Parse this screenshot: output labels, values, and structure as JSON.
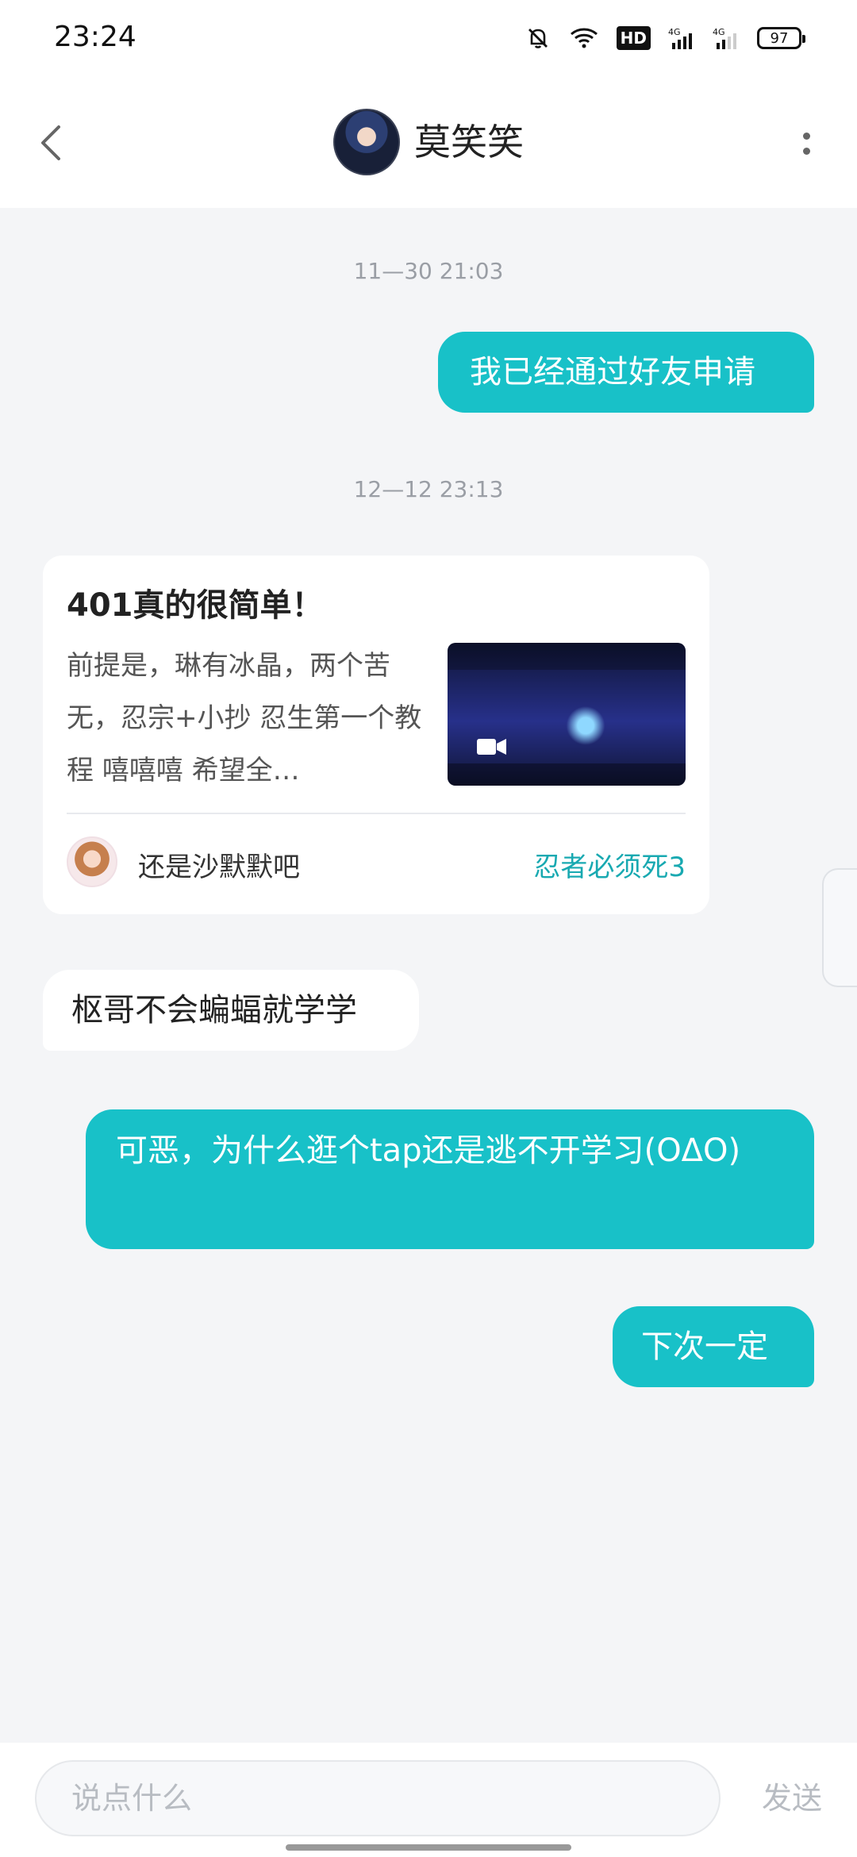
{
  "status_bar": {
    "time": "23:24",
    "hd_label": "HD",
    "battery_level": "97"
  },
  "header": {
    "contact_name": "莫笑笑"
  },
  "chat": {
    "timestamps": [
      "11—30 21:03",
      "12—12 23:13"
    ],
    "messages": [
      {
        "sender": "me",
        "text": "我已经通过好友申请"
      },
      {
        "sender": "other",
        "text": "枢哥不会蝙蝠就学学"
      },
      {
        "sender": "me",
        "text": "可恶，为什么逛个tap还是逃不开学习(ΟΔΟ)"
      },
      {
        "sender": "me",
        "text": "下次一定"
      }
    ],
    "share_card": {
      "title": "401真的很简单！",
      "description": "前提是，琳有冰晶，两个苦无，忍宗+小抄 忍生第一个教程 嘻嘻嘻 希望全…",
      "author": "还是沙默默吧",
      "game": "忍者必须死3"
    }
  },
  "input": {
    "placeholder": "说点什么",
    "send_label": "发送"
  },
  "icons": {
    "back": "back-chevron-icon",
    "more": "more-vertical-icon",
    "video": "video-icon",
    "mute": "muted-bell-icon",
    "wifi": "wifi-icon",
    "signal": "signal-icon",
    "battery": "battery-icon"
  },
  "colors": {
    "accent": "#18c1c8",
    "link": "#18a9b1",
    "background": "#f4f5f7"
  }
}
